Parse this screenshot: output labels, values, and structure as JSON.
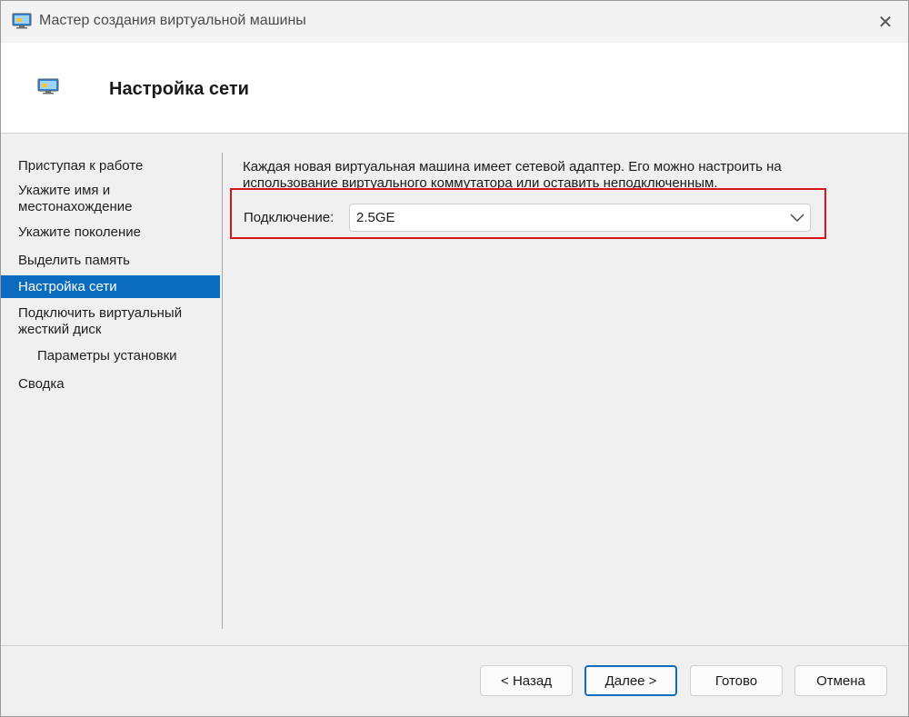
{
  "window": {
    "title": "Мастер создания виртуальной машины",
    "close_glyph": "✕",
    "icon": "vm-monitor-icon"
  },
  "header": {
    "title": "Настройка сети",
    "icon": "vm-monitor-icon"
  },
  "sidebar": {
    "items": [
      {
        "label": "Приступая к работе"
      },
      {
        "label": "Укажите имя и местонахождение"
      },
      {
        "label": "Укажите поколение"
      },
      {
        "label": "Выделить память"
      },
      {
        "label": "Настройка сети"
      },
      {
        "label": "Подключить виртуальный жесткий диск"
      },
      {
        "label": "Параметры установки"
      },
      {
        "label": "Сводка"
      }
    ],
    "active_index": 4
  },
  "main": {
    "description": "Каждая новая виртуальная машина имеет сетевой адаптер. Его можно настроить на использование виртуального коммутатора или оставить неподключенным.",
    "connection_label": "Подключение:",
    "connection_value": "2.5GE",
    "highlight_color": "#d8151c"
  },
  "buttons": {
    "back": "< Назад",
    "next": "Далее >",
    "finish": "Готово",
    "cancel": "Отмена"
  },
  "colors": {
    "accent": "#0b6cbf",
    "highlight": "#d8151c"
  }
}
